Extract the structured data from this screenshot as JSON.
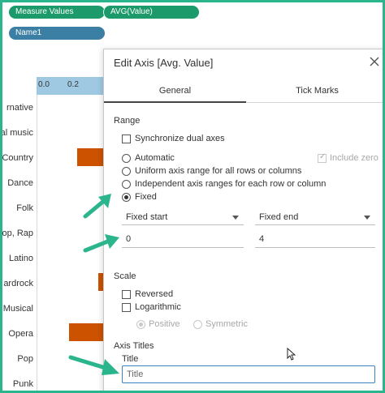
{
  "shelves": {
    "measure_values": "Measure Values",
    "avg_value": "AVG(Value)",
    "name": "Name1"
  },
  "viz": {
    "ticks": [
      "0.0",
      "0.2"
    ],
    "categories": [
      "rnative",
      "al music",
      "Country",
      "Dance",
      "Folk",
      "op, Rap",
      "Latino",
      "ardrock",
      "Musical",
      "Opera",
      "Pop",
      "Punk"
    ],
    "bar_color": "#cc5200"
  },
  "dialog": {
    "title": "Edit Axis [Avg. Value]",
    "close_icon": "close-icon",
    "tabs": [
      "General",
      "Tick Marks"
    ],
    "range": {
      "heading": "Range",
      "synchronize": "Synchronize dual axes",
      "automatic": "Automatic",
      "include_zero": "Include zero",
      "uniform": "Uniform axis range for all rows or columns",
      "independent": "Independent axis ranges for each row or column",
      "fixed": "Fixed",
      "selected": "Fixed",
      "fixed_start_label": "Fixed start",
      "fixed_end_label": "Fixed end",
      "start_value": "0",
      "end_value": "4"
    },
    "scale": {
      "heading": "Scale",
      "reversed": "Reversed",
      "logarithmic": "Logarithmic",
      "positive": "Positive",
      "symmetric": "Symmetric"
    },
    "axis_titles": {
      "heading": "Axis Titles",
      "title_label": "Title",
      "title_value": "Title"
    }
  },
  "colors": {
    "accent_green": "#1c9a6c",
    "frame_green": "#2bb58c",
    "pill_blue": "#3c7fa4",
    "focus_blue": "#3b82c4"
  }
}
